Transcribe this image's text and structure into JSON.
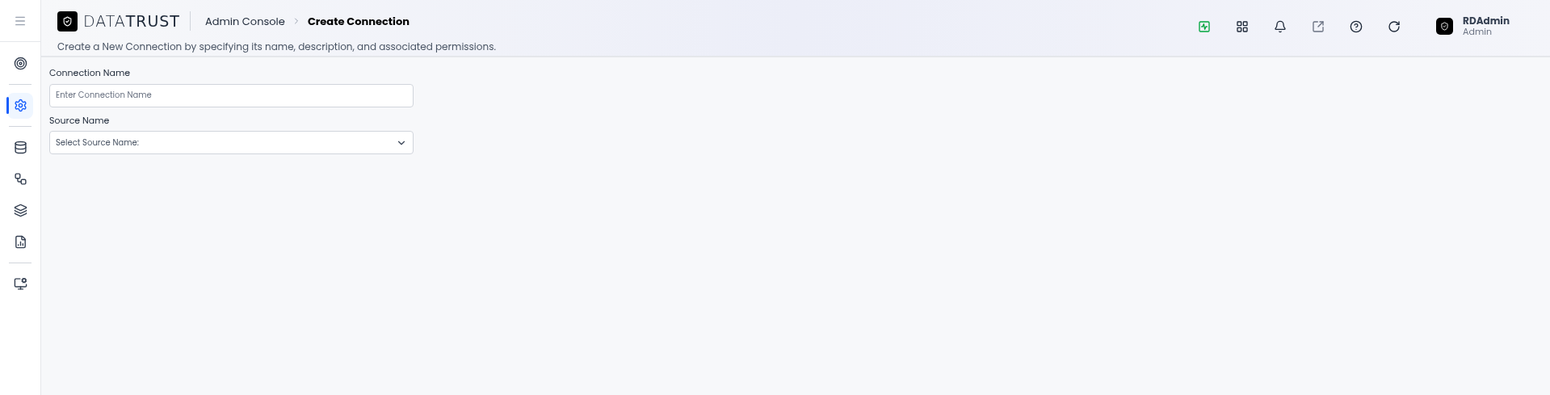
{
  "logo": {
    "text": "DATA**TRUST**"
  },
  "breadcrumb": [
    {
      "label": "Admin Console",
      "current": false
    },
    {
      "label": "Create Connection",
      "current": true
    }
  ],
  "subtitle": "Create a New Connection by specifying its name, description, and associated permissions.",
  "sidebar": {
    "groups": [
      [
        {
          "kind": "target",
          "selected": false
        }
      ],
      [
        {
          "kind": "settings",
          "selected": true
        }
      ],
      [
        {
          "kind": "database",
          "selected": false
        },
        {
          "kind": "workflow",
          "selected": false
        },
        {
          "kind": "layers",
          "selected": false
        },
        {
          "kind": "report",
          "selected": false
        }
      ],
      [
        {
          "kind": "monitor",
          "selected": false
        }
      ]
    ]
  },
  "toolbar": [
    {
      "kind": "activity"
    },
    {
      "kind": "grid"
    },
    {
      "kind": "bell"
    },
    {
      "kind": "external"
    },
    {
      "kind": "help"
    },
    {
      "kind": "refresh"
    }
  ],
  "user": {
    "name": "RDAdmin",
    "role": "Admin"
  },
  "form": {
    "fields": [
      {
        "label": "Connection Name",
        "kind": "text",
        "placeholder": "Enter Connection Name"
      },
      {
        "label": "Source Name",
        "kind": "select",
        "value": "Select Source Name:"
      }
    ]
  }
}
